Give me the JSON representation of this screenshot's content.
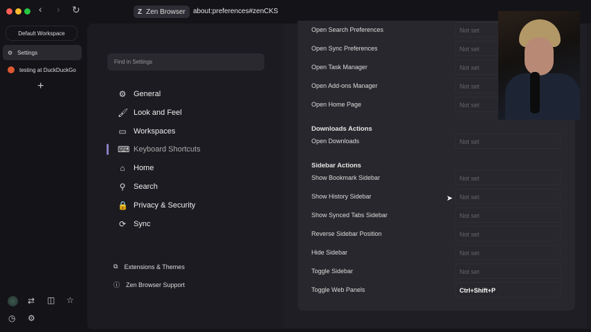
{
  "titlebar": {
    "pill_label": "Zen Browser",
    "url": "about:preferences#zenCKS"
  },
  "sidebar": {
    "workspace": "Default Workspace",
    "tabs": [
      {
        "label": "Settings",
        "icon": "gear-icon"
      },
      {
        "label": "testing at DuckDuckGo",
        "icon": "duckduckgo-icon"
      }
    ]
  },
  "settings": {
    "search_placeholder": "Find in Settings",
    "nav": [
      {
        "label": "General",
        "icon": "⚙"
      },
      {
        "label": "Look and Feel",
        "icon": "🖌"
      },
      {
        "label": "Workspaces",
        "icon": "▭"
      },
      {
        "label": "Keyboard Shortcuts",
        "icon": "⌨",
        "active": true
      },
      {
        "label": "Home",
        "icon": "⌂"
      },
      {
        "label": "Search",
        "icon": "⚲"
      },
      {
        "label": "Privacy & Security",
        "icon": "🔒"
      },
      {
        "label": "Sync",
        "icon": "⟳"
      }
    ],
    "footer": [
      {
        "label": "Extensions & Themes",
        "icon": "puzzle-icon"
      },
      {
        "label": "Zen Browser Support",
        "icon": "help-icon"
      }
    ]
  },
  "shortcuts": {
    "rows": [
      {
        "label": "Open Search Preferences",
        "value": "Not set"
      },
      {
        "label": "Open Sync Preferences",
        "value": "Not set"
      },
      {
        "label": "Open Task Manager",
        "value": "Not set"
      },
      {
        "label": "Open Add-ons Manager",
        "value": "Not set"
      },
      {
        "label": "Open Home Page",
        "value": "Not set"
      },
      {
        "header": "Downloads Actions"
      },
      {
        "label": "Open Downloads",
        "value": "Not set"
      },
      {
        "header": "Sidebar Actions"
      },
      {
        "label": "Show Bookmark Sidebar",
        "value": "Not set"
      },
      {
        "label": "Show History Sidebar",
        "value": "Not set"
      },
      {
        "label": "Show Synced Tabs Sidebar",
        "value": "Not set"
      },
      {
        "label": "Reverse Sidebar Position",
        "value": "Not set"
      },
      {
        "label": "Hide Sidebar",
        "value": "Not set"
      },
      {
        "label": "Toggle Sidebar",
        "value": "Not set"
      },
      {
        "label": "Toggle Web Panels",
        "value": "Ctrl+Shift+P"
      }
    ]
  },
  "colors": {
    "active_indicator": "#8b7fc4",
    "accent_close": "#ff5f57",
    "accent_min": "#febc2e",
    "accent_max": "#28c840"
  }
}
